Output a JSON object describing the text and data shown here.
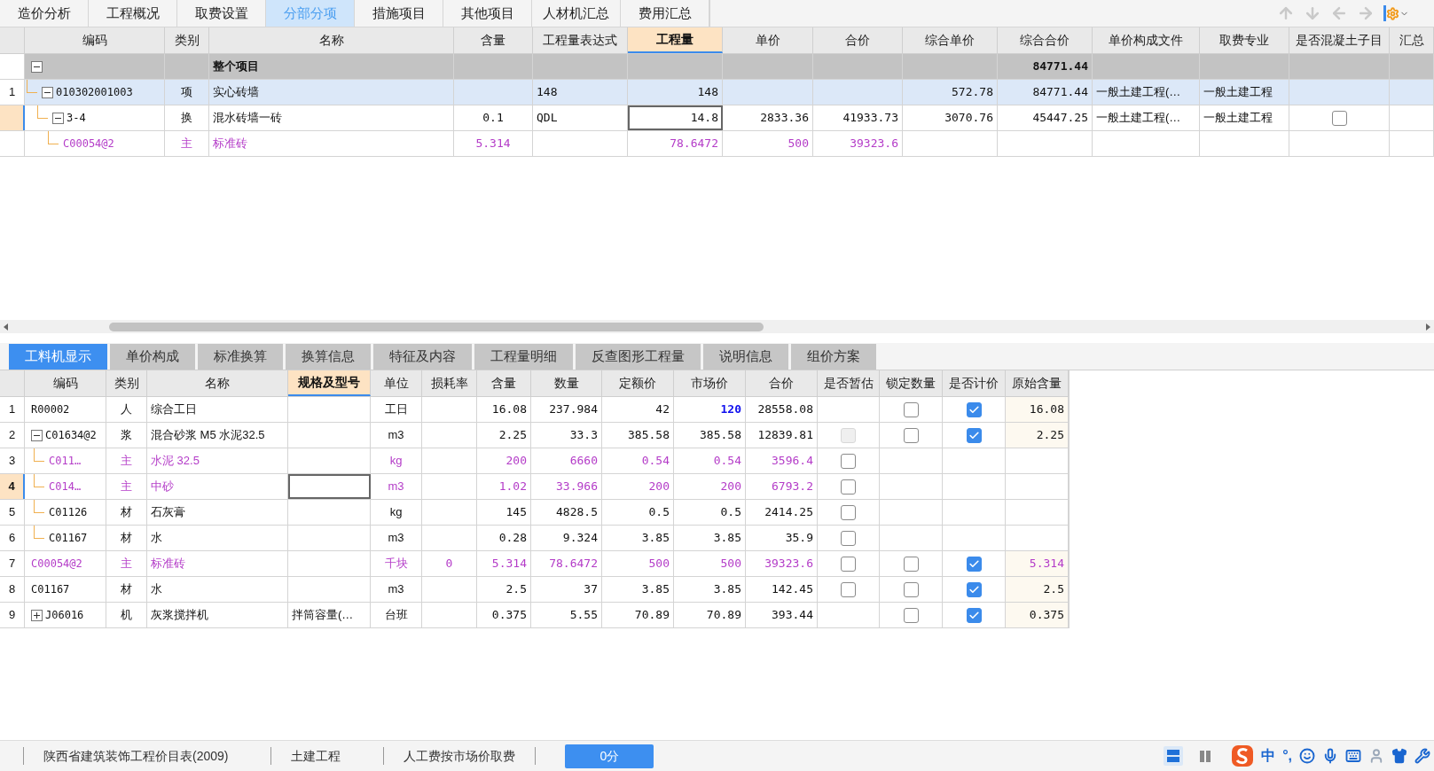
{
  "top_tabs": [
    {
      "label": "造价分析",
      "selected": false
    },
    {
      "label": "工程概况",
      "selected": false
    },
    {
      "label": "取费设置",
      "selected": false
    },
    {
      "label": "分部分项",
      "selected": true
    },
    {
      "label": "措施项目",
      "selected": false
    },
    {
      "label": "其他项目",
      "selected": false
    },
    {
      "label": "人材机汇总",
      "selected": false
    },
    {
      "label": "费用汇总",
      "selected": false
    }
  ],
  "toolbar": [
    {
      "kind": "up",
      "disabled": true
    },
    {
      "kind": "down",
      "disabled": true
    },
    {
      "kind": "left",
      "disabled": true
    },
    {
      "kind": "right",
      "disabled": true
    },
    {
      "kind": "settings",
      "disabled": false
    }
  ],
  "top_table": {
    "columns": [
      {
        "label": "编码",
        "selected": false
      },
      {
        "label": "类别",
        "selected": false
      },
      {
        "label": "名称",
        "selected": false
      },
      {
        "label": "含量",
        "selected": false
      },
      {
        "label": "工程量表达式",
        "selected": false
      },
      {
        "label": "工程量",
        "selected": true
      },
      {
        "label": "单价",
        "selected": false
      },
      {
        "label": "合价",
        "selected": false
      },
      {
        "label": "综合单价",
        "selected": false
      },
      {
        "label": "综合合价",
        "selected": false
      },
      {
        "label": "单价构成文件",
        "selected": false
      },
      {
        "label": "取费专业",
        "selected": false
      },
      {
        "label": "是否混凝土子目",
        "selected": false
      },
      {
        "label": "汇总",
        "selected": false
      }
    ],
    "rows": [
      {
        "kind": "group",
        "selected": false,
        "expanded": true,
        "cells": [
          null,
          null,
          "整个项目",
          null,
          null,
          null,
          null,
          null,
          null,
          "84771.44",
          null,
          null,
          null,
          null
        ],
        "children": [
          {
            "kind": "item",
            "number": "1",
            "selected": false,
            "expanded": true,
            "cells": [
              "010302001003",
              "项",
              "实心砖墙",
              null,
              "148",
              "148",
              null,
              null,
              "572.78",
              "84771.44",
              "一般土建工程(…",
              "一般土建工程",
              null,
              null
            ],
            "children": [
              {
                "kind": "normal",
                "selected": true,
                "expanded": true,
                "cells": [
                  "3-4",
                  "换",
                  "混水砖墙一砖",
                  "0.1",
                  "QDL",
                  "14.8",
                  "2833.36",
                  "41933.73",
                  "3070.76",
                  "45447.25",
                  "一般土建工程(…",
                  "一般土建工程",
                  {
                    "checked": false
                  },
                  null
                ],
                "children": [
                  {
                    "kind": "main",
                    "selected": false,
                    "cells": [
                      "C00054@2",
                      "主",
                      "标准砖",
                      "5.314",
                      null,
                      "78.6472",
                      "500",
                      "39323.6",
                      null,
                      null,
                      null,
                      null,
                      null,
                      null
                    ]
                  }
                ]
              }
            ]
          }
        ]
      }
    ]
  },
  "scrollbar": {
    "kind": "horizontal"
  },
  "bottom_tabs": [
    {
      "label": "工料机显示",
      "selected": true
    },
    {
      "label": "单价构成",
      "selected": false
    },
    {
      "label": "标准换算",
      "selected": false
    },
    {
      "label": "换算信息",
      "selected": false
    },
    {
      "label": "特征及内容",
      "selected": false
    },
    {
      "label": "工程量明细",
      "selected": false
    },
    {
      "label": "反查图形工程量",
      "selected": false
    },
    {
      "label": "说明信息",
      "selected": false
    },
    {
      "label": "组价方案",
      "selected": false
    }
  ],
  "bottom_table": {
    "columns": [
      {
        "label": "编码",
        "selected": false
      },
      {
        "label": "类别",
        "selected": false
      },
      {
        "label": "名称",
        "selected": false
      },
      {
        "label": "规格及型号",
        "selected": true
      },
      {
        "label": "单位",
        "selected": false
      },
      {
        "label": "损耗率",
        "selected": false
      },
      {
        "label": "含量",
        "selected": false
      },
      {
        "label": "数量",
        "selected": false
      },
      {
        "label": "定额价",
        "selected": false
      },
      {
        "label": "市场价",
        "selected": false
      },
      {
        "label": "合价",
        "selected": false
      },
      {
        "label": "是否暂估",
        "selected": false
      },
      {
        "label": "锁定数量",
        "selected": false
      },
      {
        "label": "是否计价",
        "selected": false
      },
      {
        "label": "原始含量",
        "selected": false
      }
    ],
    "rows": [
      {
        "kind": "normal",
        "number": "1",
        "selected": false,
        "cells": [
          "R00002",
          "人",
          "综合工日",
          null,
          "工日",
          null,
          "16.08",
          "237.984",
          "42",
          {
            "text": "120",
            "highlighted": true
          },
          "28558.08",
          null,
          {
            "checked": false
          },
          {
            "checked": true
          },
          "16.08"
        ]
      },
      {
        "kind": "normal",
        "number": "2",
        "selected": false,
        "expanded": true,
        "cells": [
          "C01634@2",
          "浆",
          "混合砂浆 M5 水泥32.5",
          null,
          "m3",
          null,
          "2.25",
          "33.3",
          "385.58",
          "385.58",
          "12839.81",
          {
            "checked": false,
            "disabled": true
          },
          {
            "checked": false
          },
          {
            "checked": true
          },
          "2.25"
        ],
        "children": [
          {
            "kind": "main",
            "number": "3",
            "selected": false,
            "cells": [
              "C011…",
              "主",
              "水泥 32.5",
              null,
              "kg",
              null,
              "200",
              "6660",
              "0.54",
              "0.54",
              "3596.4",
              {
                "checked": false
              },
              null,
              null,
              null
            ]
          },
          {
            "kind": "main",
            "number": "4",
            "selected": true,
            "cells": [
              "C014…",
              "主",
              "中砂",
              null,
              "m3",
              null,
              "1.02",
              "33.966",
              "200",
              "200",
              "6793.2",
              {
                "checked": false
              },
              null,
              null,
              null
            ]
          },
          {
            "kind": "normal",
            "number": "5",
            "selected": false,
            "cells": [
              "C01126",
              "材",
              "石灰膏",
              null,
              "kg",
              null,
              "145",
              "4828.5",
              "0.5",
              "0.5",
              "2414.25",
              {
                "checked": false
              },
              null,
              null,
              null
            ]
          },
          {
            "kind": "normal",
            "number": "6",
            "selected": false,
            "cells": [
              "C01167",
              "材",
              "水",
              null,
              "m3",
              null,
              "0.28",
              "9.324",
              "3.85",
              "3.85",
              "35.9",
              {
                "checked": false
              },
              null,
              null,
              null
            ]
          }
        ]
      },
      {
        "kind": "main",
        "number": "7",
        "selected": false,
        "cells": [
          "C00054@2",
          "主",
          "标准砖",
          null,
          "千块",
          "0",
          "5.314",
          "78.6472",
          "500",
          "500",
          "39323.6",
          {
            "checked": false
          },
          {
            "checked": false
          },
          {
            "checked": true
          },
          "5.314"
        ]
      },
      {
        "kind": "normal",
        "number": "8",
        "selected": false,
        "cells": [
          "C01167",
          "材",
          "水",
          null,
          "m3",
          null,
          "2.5",
          "37",
          "3.85",
          "3.85",
          "142.45",
          {
            "checked": false
          },
          {
            "checked": false
          },
          {
            "checked": true
          },
          "2.5"
        ]
      },
      {
        "kind": "normal",
        "number": "9",
        "selected": false,
        "expanded": false,
        "cells": [
          "J06016",
          "机",
          "灰浆搅拌机",
          "拌筒容量(…",
          "台班",
          null,
          "0.375",
          "5.55",
          "70.89",
          "70.89",
          "393.44",
          null,
          {
            "checked": false
          },
          {
            "checked": true
          },
          "0.375"
        ]
      }
    ]
  },
  "status_bar": {
    "items": [
      "陕西省建筑装饰工程价目表(2009)",
      "土建工程",
      "人工费按市场价取费"
    ],
    "score": "0分",
    "view_buttons": [
      {
        "kind": "rows",
        "selected": true
      },
      {
        "kind": "columns",
        "selected": false
      }
    ],
    "ime": [
      {
        "kind": "logo"
      },
      {
        "kind": "text",
        "label": "中"
      },
      {
        "kind": "text",
        "label": "°,"
      },
      {
        "kind": "emoji"
      },
      {
        "kind": "mic"
      },
      {
        "kind": "keyboard"
      },
      {
        "kind": "user"
      },
      {
        "kind": "shirt"
      },
      {
        "kind": "wrench"
      }
    ]
  }
}
